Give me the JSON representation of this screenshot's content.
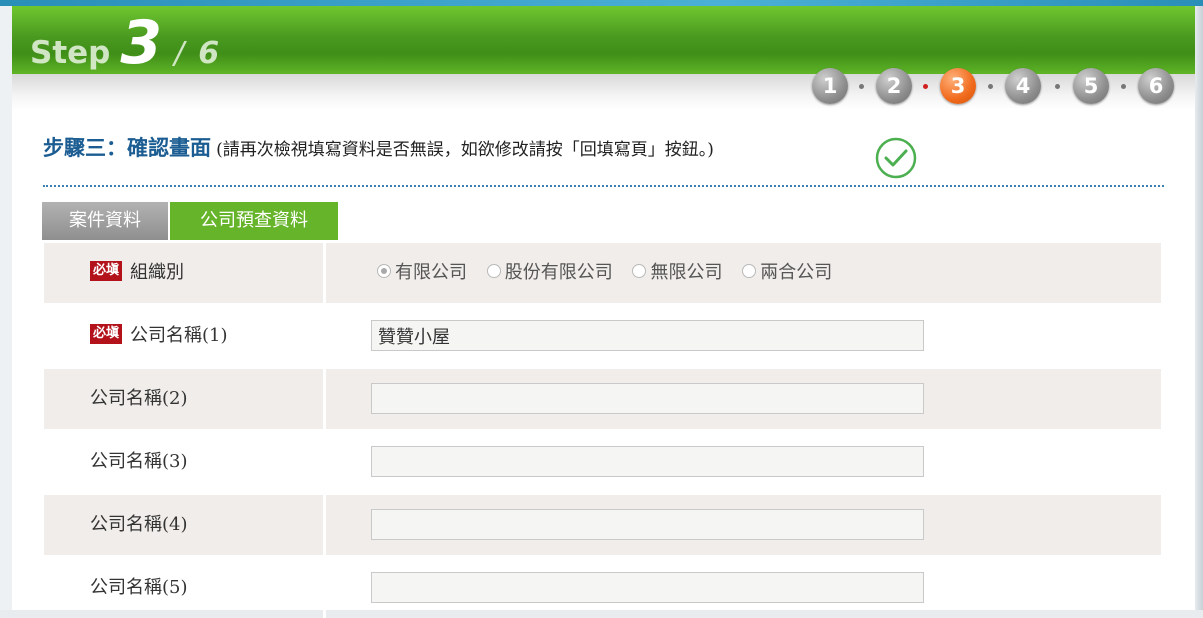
{
  "header": {
    "step_word": "Step",
    "step_current": "3",
    "step_separator": "/",
    "step_total": "6",
    "steps": [
      "1",
      "2",
      "3",
      "4",
      "5",
      "6"
    ],
    "active_step": 3
  },
  "heading": {
    "title": "步驟三：確認畫面",
    "note": "(請再次檢視填寫資料是否無誤，如欲修改請按「回填寫頁」按鈕。)",
    "check_icon": "check-circle-icon"
  },
  "tabs": [
    {
      "label": "案件資料",
      "active": false
    },
    {
      "label": "公司預查資料",
      "active": true
    }
  ],
  "form": {
    "required_badge": "必塡",
    "org_type": {
      "label": "組織別",
      "options": [
        "有限公司",
        "股份有限公司",
        "無限公司",
        "兩合公司"
      ],
      "selected": "有限公司"
    },
    "names": [
      {
        "label": "公司名稱(1)",
        "value": "贊贊小屋",
        "required": true
      },
      {
        "label": "公司名稱(2)",
        "value": ""
      },
      {
        "label": "公司名稱(3)",
        "value": ""
      },
      {
        "label": "公司名稱(4)",
        "value": ""
      },
      {
        "label": "公司名稱(5)",
        "value": ""
      }
    ]
  },
  "colors": {
    "header_green": "#4a9a20",
    "tab_active": "#66b42a",
    "tab_inactive": "#9e9e9e",
    "title_blue": "#1b5d92",
    "step_active": "#f06a1c",
    "required_badge": "#b3121b",
    "check_green": "#4caf50"
  }
}
